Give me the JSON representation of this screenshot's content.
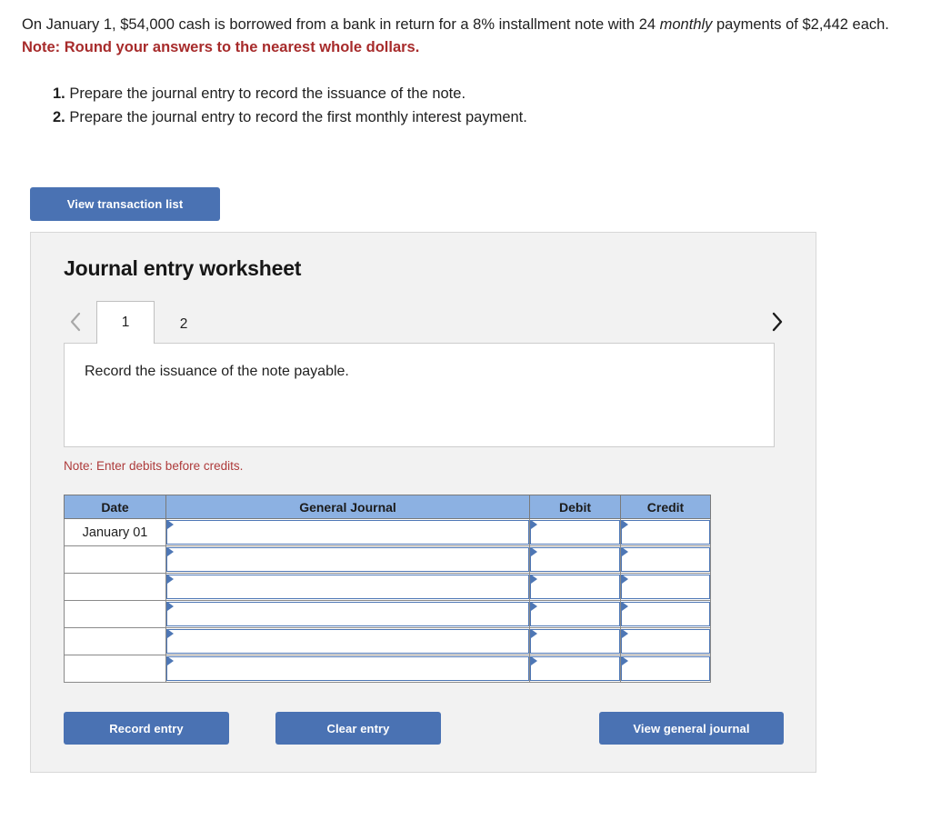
{
  "problem": {
    "statement_part1": "On January 1, $54,000 cash is borrowed from a bank in return for a 8% installment note with 24 ",
    "statement_italic": "monthly",
    "statement_part2": " payments of $2,442 each.",
    "rounding_note": "Note: Round your answers to the nearest whole dollars.",
    "tasks": [
      {
        "num": "1.",
        "text": " Prepare the journal entry to record the issuance of the note."
      },
      {
        "num": "2.",
        "text": " Prepare the journal entry to record the first monthly interest payment."
      }
    ]
  },
  "toolbar": {
    "view_transaction_list_label": "View transaction list"
  },
  "worksheet": {
    "title": "Journal entry worksheet",
    "prev_icon": "chevron-left-icon",
    "next_icon": "chevron-right-icon",
    "tabs": [
      {
        "label": "1",
        "active": true
      },
      {
        "label": "2",
        "active": false
      }
    ],
    "description": "Record the issuance of the note payable.",
    "debits_note": "Note: Enter debits before credits.",
    "table": {
      "headers": [
        "Date",
        "General Journal",
        "Debit",
        "Credit"
      ],
      "rows": [
        {
          "date": "January 01",
          "general_journal": "",
          "debit": "",
          "credit": ""
        },
        {
          "date": "",
          "general_journal": "",
          "debit": "",
          "credit": ""
        },
        {
          "date": "",
          "general_journal": "",
          "debit": "",
          "credit": ""
        },
        {
          "date": "",
          "general_journal": "",
          "debit": "",
          "credit": ""
        },
        {
          "date": "",
          "general_journal": "",
          "debit": "",
          "credit": ""
        },
        {
          "date": "",
          "general_journal": "",
          "debit": "",
          "credit": ""
        }
      ]
    },
    "buttons": {
      "record_entry": "Record entry",
      "clear_entry": "Clear entry",
      "view_general_journal": "View general journal"
    }
  },
  "colors": {
    "button_blue": "#4a72b3",
    "header_blue": "#8cb1e2",
    "input_border_blue": "#4e77b5",
    "note_red": "#a72b2b",
    "panel_gray": "#f2f2f2"
  }
}
